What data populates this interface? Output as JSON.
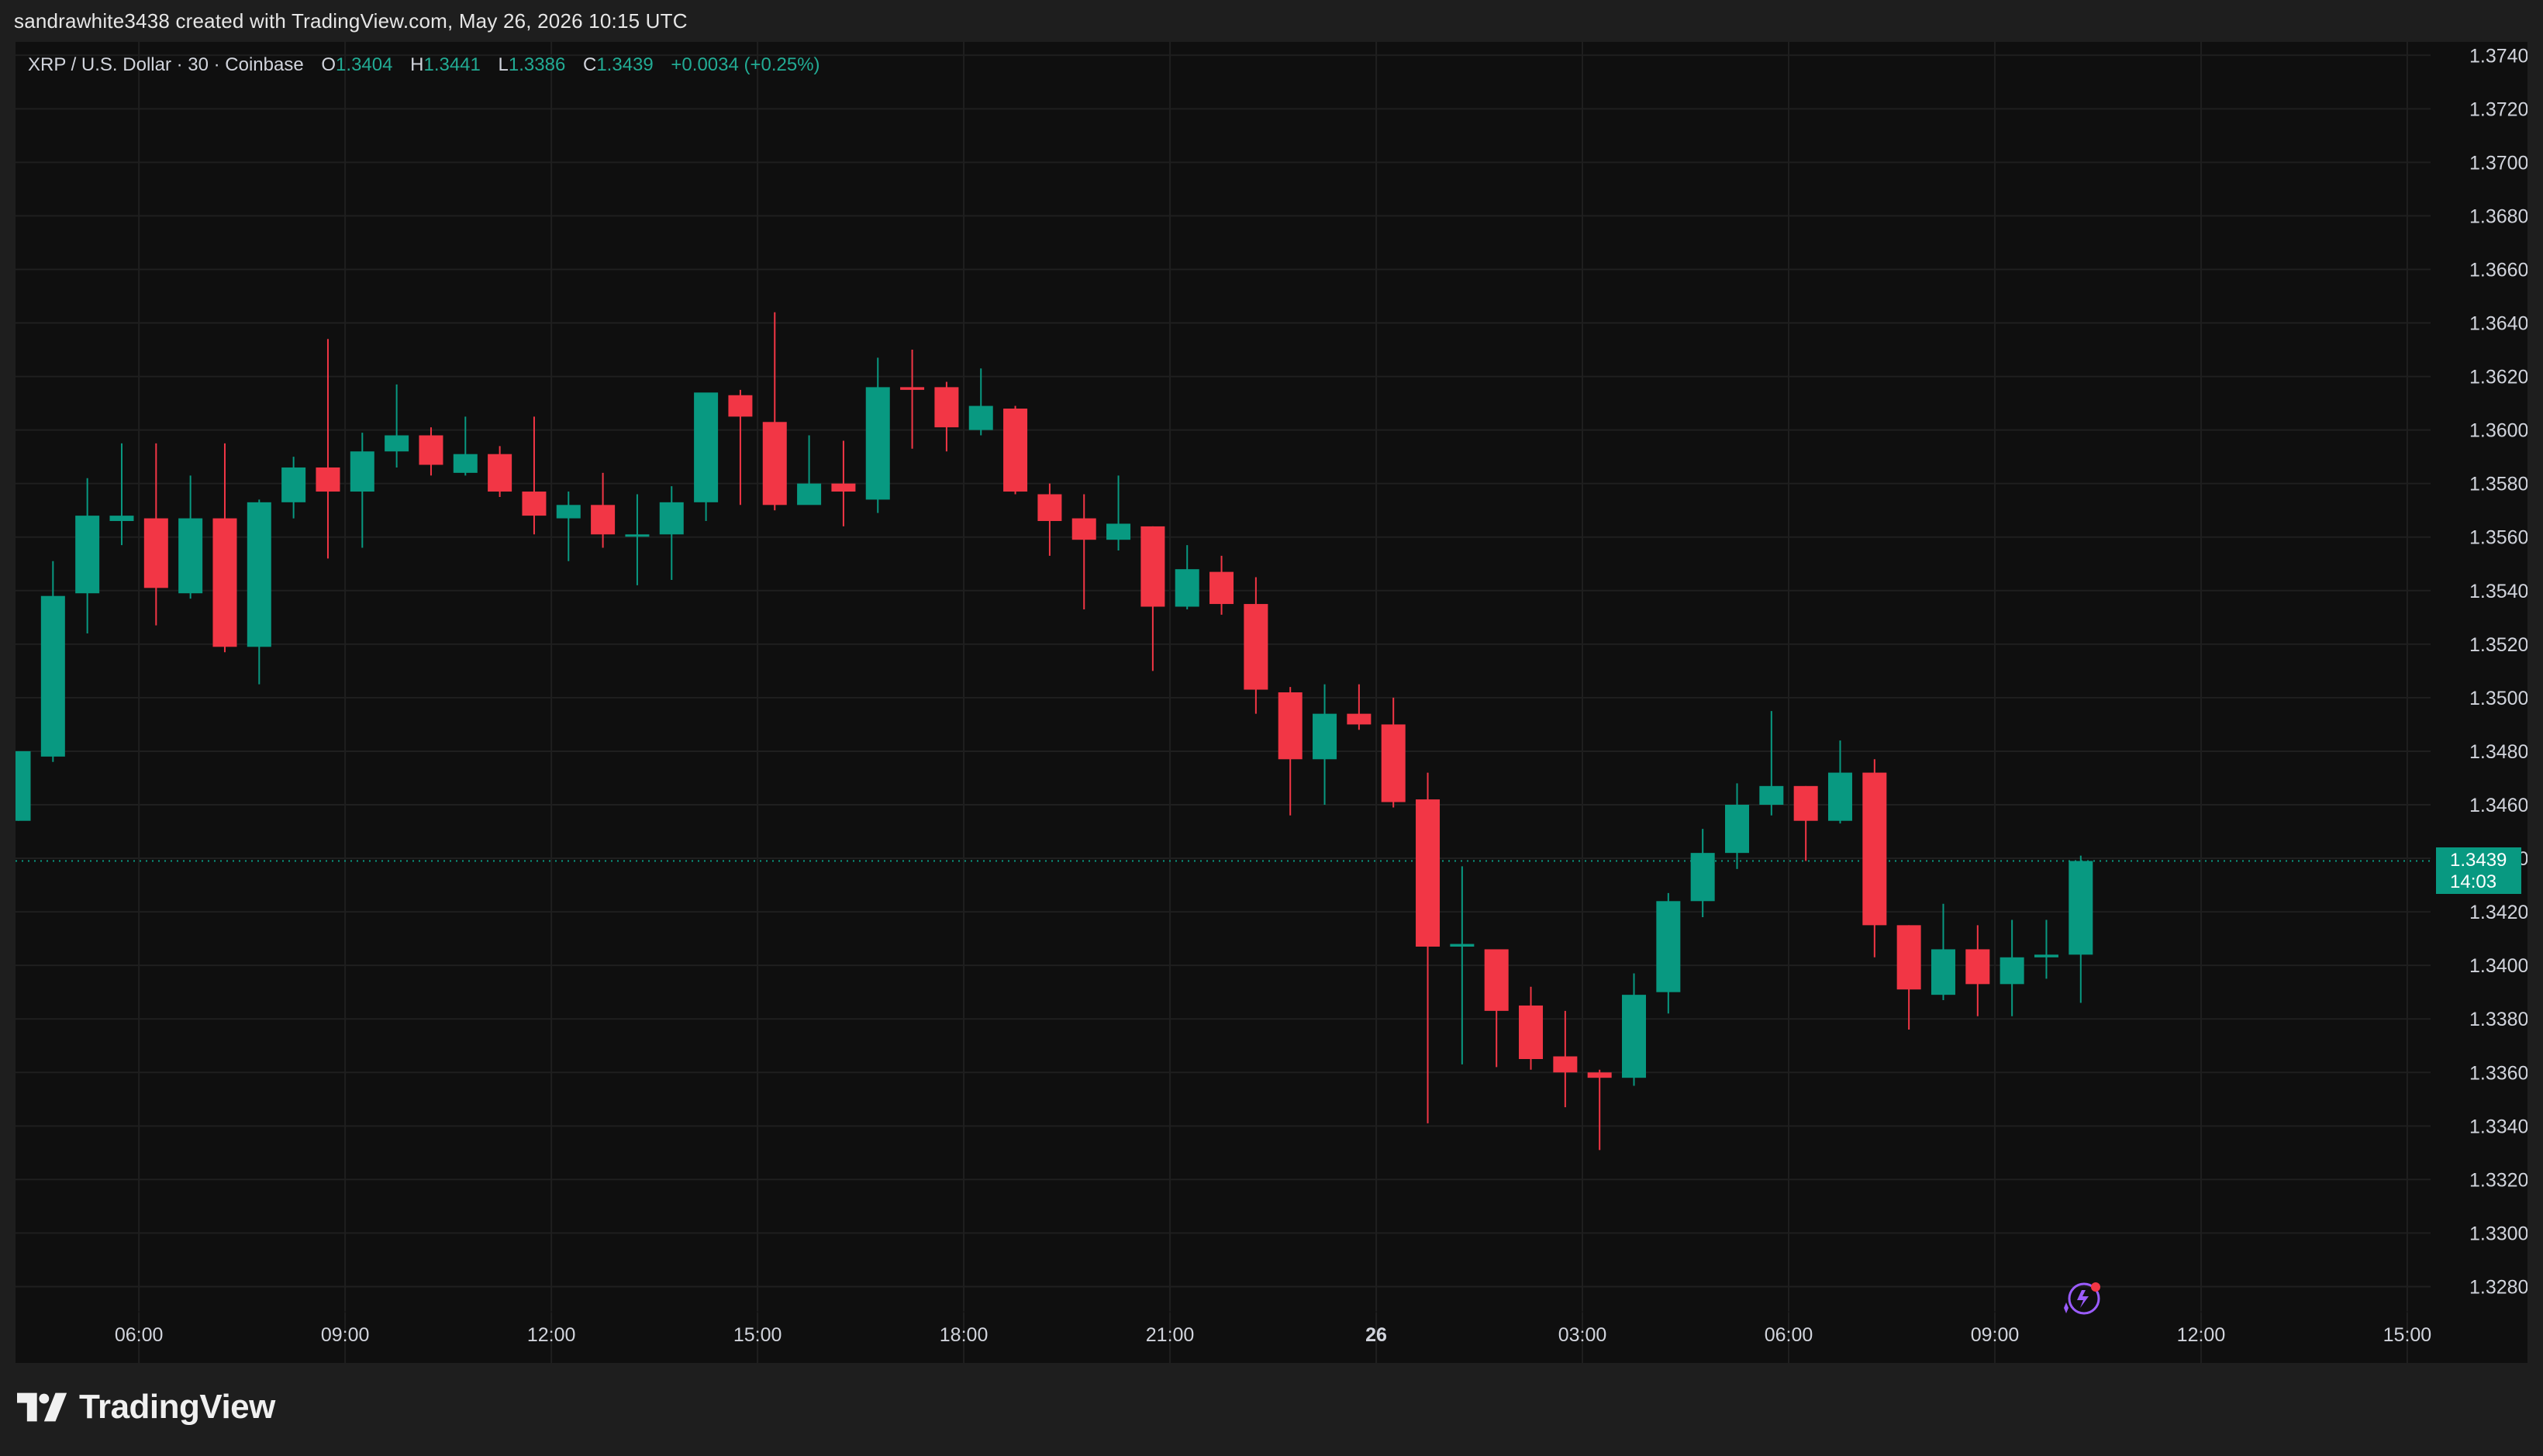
{
  "attribution": "sandrawhite3438 created with TradingView.com, May 26, 2026 10:15 UTC",
  "legend": {
    "symbol": "XRP / U.S. Dollar · 30 · Coinbase",
    "open_label": "O",
    "open": "1.3404",
    "high_label": "H",
    "high": "1.3441",
    "low_label": "L",
    "low": "1.3386",
    "close_label": "C",
    "close": "1.3439",
    "change": "+0.0034 (+0.25%)"
  },
  "price_badge": {
    "price": "1.3439",
    "countdown": "14:03"
  },
  "footer": {
    "brand": "TradingView",
    "logo_icon": "tradingview-logo-icon"
  },
  "colors": {
    "up": "#089981",
    "down": "#f23645",
    "background": "#0f0f0f",
    "grid": "#1f1f1f"
  },
  "chart_data": {
    "type": "candlestick",
    "interval": "30",
    "y_axis_side": "right",
    "ylim": [
      1.327,
      1.3745
    ],
    "grid": true,
    "yticks": [
      "1.3280",
      "1.3300",
      "1.3320",
      "1.3340",
      "1.3360",
      "1.3380",
      "1.3400",
      "1.3420",
      "1.3440",
      "1.3460",
      "1.3480",
      "1.3500",
      "1.3520",
      "1.3540",
      "1.3560",
      "1.3580",
      "1.3600",
      "1.3620",
      "1.3640",
      "1.3660",
      "1.3680",
      "1.3700",
      "1.3720",
      "1.3740"
    ],
    "xticks": [
      {
        "label": "06:00",
        "bar": 3.5
      },
      {
        "label": "09:00",
        "bar": 9.5
      },
      {
        "label": "12:00",
        "bar": 15.5
      },
      {
        "label": "15:00",
        "bar": 21.5
      },
      {
        "label": "18:00",
        "bar": 27.5
      },
      {
        "label": "21:00",
        "bar": 33.5
      },
      {
        "label": "26",
        "bar": 39.5,
        "bold": true
      },
      {
        "label": "03:00",
        "bar": 45.5
      },
      {
        "label": "06:00",
        "bar": 51.5
      },
      {
        "label": "09:00",
        "bar": 57.5
      },
      {
        "label": "12:00",
        "bar": 63.5
      },
      {
        "label": "15:00",
        "bar": 69.5
      }
    ],
    "candles": [
      {
        "o": 1.3454,
        "h": 1.348,
        "l": 1.3454,
        "c": 1.348
      },
      {
        "o": 1.3478,
        "h": 1.3551,
        "l": 1.3476,
        "c": 1.3538
      },
      {
        "o": 1.3539,
        "h": 1.3582,
        "l": 1.3524,
        "c": 1.3568
      },
      {
        "o": 1.3566,
        "h": 1.3595,
        "l": 1.3557,
        "c": 1.3568
      },
      {
        "o": 1.3567,
        "h": 1.3595,
        "l": 1.3527,
        "c": 1.3541
      },
      {
        "o": 1.3539,
        "h": 1.3583,
        "l": 1.3537,
        "c": 1.3567
      },
      {
        "o": 1.3567,
        "h": 1.3595,
        "l": 1.3517,
        "c": 1.3519
      },
      {
        "o": 1.3519,
        "h": 1.3574,
        "l": 1.3505,
        "c": 1.3573
      },
      {
        "o": 1.3573,
        "h": 1.359,
        "l": 1.3567,
        "c": 1.3586
      },
      {
        "o": 1.3586,
        "h": 1.3634,
        "l": 1.3552,
        "c": 1.3577
      },
      {
        "o": 1.3577,
        "h": 1.3599,
        "l": 1.3556,
        "c": 1.3592
      },
      {
        "o": 1.3592,
        "h": 1.3617,
        "l": 1.3586,
        "c": 1.3598
      },
      {
        "o": 1.3598,
        "h": 1.3601,
        "l": 1.3583,
        "c": 1.3587
      },
      {
        "o": 1.3584,
        "h": 1.3605,
        "l": 1.3583,
        "c": 1.3591
      },
      {
        "o": 1.3591,
        "h": 1.3594,
        "l": 1.3575,
        "c": 1.3577
      },
      {
        "o": 1.3577,
        "h": 1.3605,
        "l": 1.3561,
        "c": 1.3568
      },
      {
        "o": 1.3567,
        "h": 1.3577,
        "l": 1.3551,
        "c": 1.3572
      },
      {
        "o": 1.3572,
        "h": 1.3584,
        "l": 1.3556,
        "c": 1.3561
      },
      {
        "o": 1.3561,
        "h": 1.3576,
        "l": 1.3542,
        "c": 1.3561
      },
      {
        "o": 1.3561,
        "h": 1.3579,
        "l": 1.3544,
        "c": 1.3573
      },
      {
        "o": 1.3573,
        "h": 1.3613,
        "l": 1.3566,
        "c": 1.3614
      },
      {
        "o": 1.3613,
        "h": 1.3615,
        "l": 1.3572,
        "c": 1.3605
      },
      {
        "o": 1.3603,
        "h": 1.3644,
        "l": 1.357,
        "c": 1.3572
      },
      {
        "o": 1.3572,
        "h": 1.3598,
        "l": 1.3573,
        "c": 1.358
      },
      {
        "o": 1.358,
        "h": 1.3596,
        "l": 1.3564,
        "c": 1.3577
      },
      {
        "o": 1.3574,
        "h": 1.3627,
        "l": 1.3569,
        "c": 1.3616
      },
      {
        "o": 1.3616,
        "h": 1.363,
        "l": 1.3593,
        "c": 1.3615
      },
      {
        "o": 1.3616,
        "h": 1.3618,
        "l": 1.3592,
        "c": 1.3601
      },
      {
        "o": 1.36,
        "h": 1.3623,
        "l": 1.3598,
        "c": 1.3609
      },
      {
        "o": 1.3608,
        "h": 1.3609,
        "l": 1.3576,
        "c": 1.3577
      },
      {
        "o": 1.3576,
        "h": 1.358,
        "l": 1.3553,
        "c": 1.3566
      },
      {
        "o": 1.3567,
        "h": 1.3576,
        "l": 1.3533,
        "c": 1.3559
      },
      {
        "o": 1.3559,
        "h": 1.3583,
        "l": 1.3555,
        "c": 1.3565
      },
      {
        "o": 1.3564,
        "h": 1.3564,
        "l": 1.351,
        "c": 1.3534
      },
      {
        "o": 1.3534,
        "h": 1.3557,
        "l": 1.3533,
        "c": 1.3548
      },
      {
        "o": 1.3547,
        "h": 1.3553,
        "l": 1.3531,
        "c": 1.3535
      },
      {
        "o": 1.3535,
        "h": 1.3545,
        "l": 1.3494,
        "c": 1.3503
      },
      {
        "o": 1.3502,
        "h": 1.3504,
        "l": 1.3456,
        "c": 1.3477
      },
      {
        "o": 1.3477,
        "h": 1.3505,
        "l": 1.346,
        "c": 1.3494
      },
      {
        "o": 1.3494,
        "h": 1.3505,
        "l": 1.3488,
        "c": 1.349
      },
      {
        "o": 1.349,
        "h": 1.35,
        "l": 1.3459,
        "c": 1.3461
      },
      {
        "o": 1.3462,
        "h": 1.3472,
        "l": 1.3341,
        "c": 1.3407
      },
      {
        "o": 1.3407,
        "h": 1.3437,
        "l": 1.3363,
        "c": 1.3408
      },
      {
        "o": 1.3406,
        "h": 1.3406,
        "l": 1.3362,
        "c": 1.3383
      },
      {
        "o": 1.3385,
        "h": 1.3392,
        "l": 1.3361,
        "c": 1.3365
      },
      {
        "o": 1.3366,
        "h": 1.3383,
        "l": 1.3347,
        "c": 1.336
      },
      {
        "o": 1.336,
        "h": 1.3361,
        "l": 1.3331,
        "c": 1.3358
      },
      {
        "o": 1.3358,
        "h": 1.3397,
        "l": 1.3355,
        "c": 1.3389
      },
      {
        "o": 1.339,
        "h": 1.3427,
        "l": 1.3382,
        "c": 1.3424
      },
      {
        "o": 1.3424,
        "h": 1.3451,
        "l": 1.3418,
        "c": 1.3442
      },
      {
        "o": 1.3442,
        "h": 1.3468,
        "l": 1.3436,
        "c": 1.346
      },
      {
        "o": 1.346,
        "h": 1.3495,
        "l": 1.3456,
        "c": 1.3467
      },
      {
        "o": 1.3467,
        "h": 1.3467,
        "l": 1.3439,
        "c": 1.3454
      },
      {
        "o": 1.3454,
        "h": 1.3484,
        "l": 1.3453,
        "c": 1.3472
      },
      {
        "o": 1.3472,
        "h": 1.3477,
        "l": 1.3403,
        "c": 1.3415
      },
      {
        "o": 1.3415,
        "h": 1.3415,
        "l": 1.3376,
        "c": 1.3391
      },
      {
        "o": 1.3389,
        "h": 1.3423,
        "l": 1.3387,
        "c": 1.3406
      },
      {
        "o": 1.3406,
        "h": 1.3415,
        "l": 1.3381,
        "c": 1.3393
      },
      {
        "o": 1.3393,
        "h": 1.3417,
        "l": 1.3381,
        "c": 1.3403
      },
      {
        "o": 1.3403,
        "h": 1.3417,
        "l": 1.3395,
        "c": 1.3404
      },
      {
        "o": 1.3404,
        "h": 1.3441,
        "l": 1.3386,
        "c": 1.3439
      }
    ]
  }
}
